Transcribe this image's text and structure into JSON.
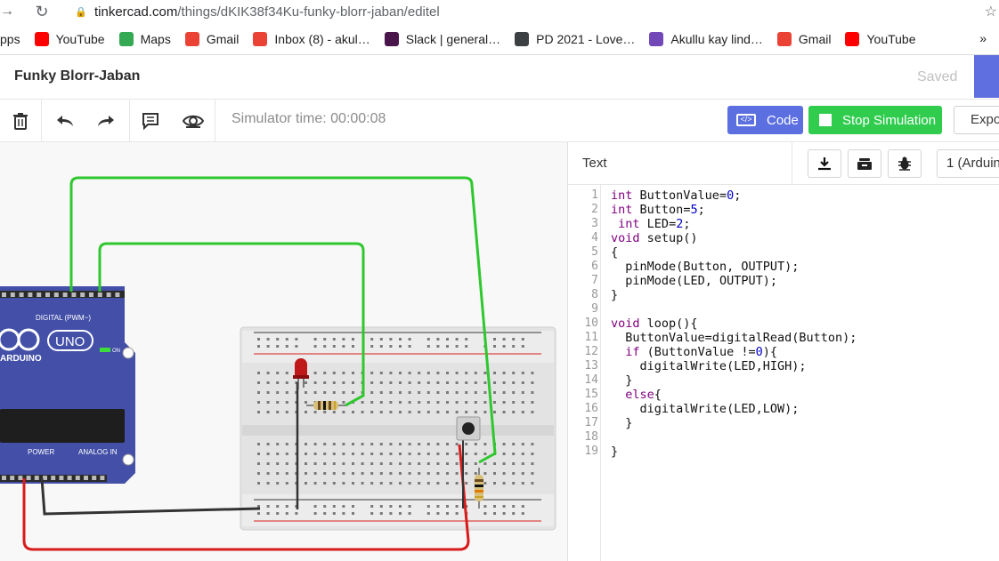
{
  "browser": {
    "url_host": "tinkercad.com",
    "url_path": "/things/dKIK38f34Ku-funky-blorr-jaban/editel"
  },
  "bookmarks": [
    {
      "label": "pps",
      "icon": "apps-icon",
      "color": "#1a73e8"
    },
    {
      "label": "YouTube",
      "icon": "youtube-icon",
      "color": "#ff0000"
    },
    {
      "label": "Maps",
      "icon": "maps-icon",
      "color": "#34a853"
    },
    {
      "label": "Gmail",
      "icon": "gmail-icon",
      "color": "#ea4335"
    },
    {
      "label": "Inbox (8) - akul…",
      "icon": "gmail-icon",
      "color": "#ea4335"
    },
    {
      "label": "Slack | general…",
      "icon": "slack-icon",
      "color": "#4a154b"
    },
    {
      "label": "PD 2021 - Love…",
      "icon": "photo-icon",
      "color": "#3c4043"
    },
    {
      "label": "Akullu kay lind…",
      "icon": "forms-icon",
      "color": "#7248b9"
    },
    {
      "label": "Gmail",
      "icon": "gmail-icon",
      "color": "#ea4335"
    },
    {
      "label": "YouTube",
      "icon": "youtube-icon",
      "color": "#ff0000"
    }
  ],
  "bookmarks_more": "»",
  "title": {
    "project_name": "Funky Blorr-Jaban",
    "status": "Saved"
  },
  "toolbar": {
    "sim_time": "Simulator time: 00:00:08",
    "code_label": "Code",
    "stop_label": "Stop Simulation",
    "export_label": "Expo"
  },
  "panel": {
    "mode": "Text",
    "device_select": "1 (Arduin"
  },
  "board": {
    "digital_label": "DIGITAL (PWM~)",
    "brand": "ARDUINO",
    "model": "UNO",
    "on_label": "ON",
    "power_label": "POWER",
    "analog_label": "ANALOG IN"
  },
  "code_lines": [
    "int ButtonValue=0;",
    "int Button=5;",
    " int LED=2;",
    "void setup()",
    "{",
    "  pinMode(Button, OUTPUT);",
    "  pinMode(LED, OUTPUT);",
    "}",
    "",
    "void loop(){",
    "  ButtonValue=digitalRead(Button);",
    "  if (ButtonValue !=0){",
    "    digitalWrite(LED,HIGH);",
    "  }",
    "  else{",
    "    digitalWrite(LED,LOW);",
    "  }",
    "",
    "}"
  ],
  "colors": {
    "accent": "#5b6fe0",
    "stop_green": "#2fcc4e",
    "arduino_blue": "#4450a8",
    "wire_green": "#2ec82e",
    "wire_red": "#d81b1b",
    "wire_black": "#333333"
  }
}
